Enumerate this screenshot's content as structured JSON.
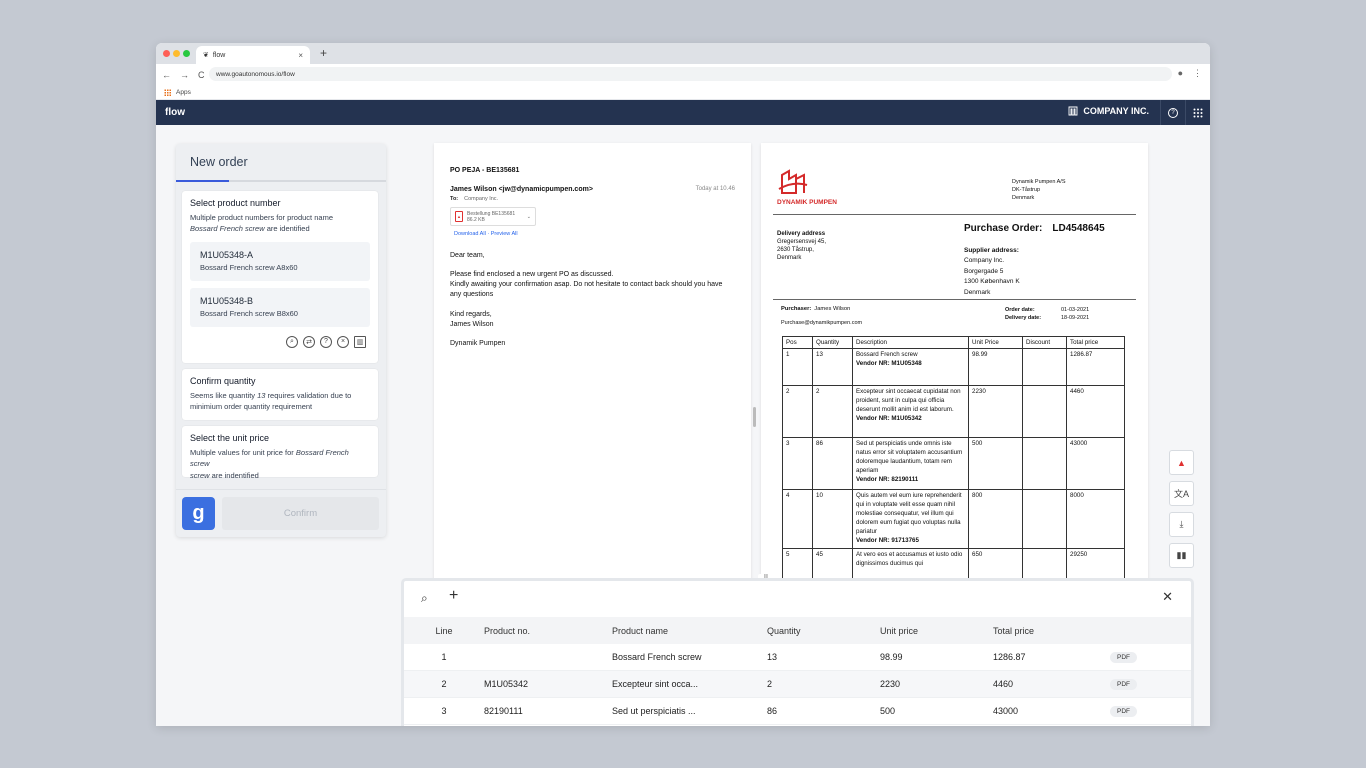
{
  "browser": {
    "tab_title": "flow",
    "tab_close": "×",
    "new_tab": "+",
    "url": "www.goautonomous.io/flow",
    "bookmark": "Apps",
    "nav_back": "←",
    "nav_forward": "→",
    "nav_reload": "C"
  },
  "appbar": {
    "brand": "flow",
    "company": "COMPANY INC.",
    "help": "?"
  },
  "panel": {
    "title": "New order",
    "progress_fraction": 0.25,
    "step1": {
      "title": "Select product number",
      "desc_part1": "Multiple product numbers for product name",
      "desc_italic": "Bossard French screw",
      "desc_part2": " are identified",
      "options": [
        {
          "number": "M1U05348-A",
          "name": "Bossard French screw A8x60"
        },
        {
          "number": "M1U05348-B",
          "name": "Bossard French screw B8x60"
        }
      ]
    },
    "step2": {
      "title": "Confirm quantity",
      "desc_part1": "Seems like quantity ",
      "desc_italic": "13",
      "desc_part2": " requires validation due to minimium order quantity requirement"
    },
    "step3": {
      "title": "Select the unit price",
      "desc_part1": "Multiple values for unit price for ",
      "desc_italic": "Bossard French screw",
      "desc_part2": " are indentified"
    },
    "logo_letter": "g",
    "confirm_label": "Confirm"
  },
  "email": {
    "subject": "PO PEJA - BE135681",
    "from": "James Wilson <jw@dynamicpumpen.com>",
    "time": "Today at 10.46",
    "to_label": "To:",
    "to_value": "Company Inc.",
    "attachment_name": "Bestellung BE135681",
    "attachment_size": "86.2 KB",
    "download_all": "Download All",
    "preview_all": "Preview All",
    "greeting": "Dear team,",
    "body_line1": "Please find enclosed a new urgent PO as discussed.",
    "body_line2": "Kindly awaiting your confirmation asap. Do not hesitate to contact back should you have any questions",
    "sign1": "Kind regards,",
    "sign2": "James Wilson",
    "company": "Dynamik Pumpen"
  },
  "po": {
    "logo_text": "DYNAMIK PUMPEN",
    "addr": [
      "Dynamik Pumpen A/S",
      "DK-Tåstrup",
      "Denmark"
    ],
    "title": "Purchase Order:",
    "number": "LD4548645",
    "delivery_label": "Delivery address",
    "delivery": [
      "Gregersensvej 45,",
      "2630 Tåstrup,",
      "Denmark"
    ],
    "supplier_label": "Supplier address:",
    "supplier": [
      "Company Inc.",
      "Borgergade 5",
      "1300 København K",
      "Denmark"
    ],
    "purchaser_label": "Purchaser:",
    "purchaser": "James Wilson",
    "purchaser_email": "Purchase@dynamikpumpen.com",
    "order_date_label": "Order date:",
    "order_date": "01-03-2021",
    "delivery_date_label": "Delivery date:",
    "delivery_date": "18-09-2021",
    "headers": [
      "Pos",
      "Quantity",
      "Description",
      "Unit Price",
      "Discount",
      "Total price"
    ],
    "rows": [
      {
        "pos": "1",
        "qty": "13",
        "desc": "Bossard French screw",
        "vendor": "Vendor NR: M1U05348",
        "unit": "98.99",
        "disc": "",
        "total": "1286.87"
      },
      {
        "pos": "2",
        "qty": "2",
        "desc": "Excepteur sint occaecat cupidatat non proident, sunt in culpa qui officia deserunt mollit anim id est laborum.",
        "vendor": "Vendor NR: M1U05342",
        "unit": "2230",
        "disc": "",
        "total": "4460"
      },
      {
        "pos": "3",
        "qty": "86",
        "desc": "Sed ut perspiciatis unde omnis iste natus error sit voluptatem accusantium doloremque laudantium, totam rem aperiam",
        "vendor": "Vendor NR: 82190111",
        "unit": "500",
        "disc": "",
        "total": "43000"
      },
      {
        "pos": "4",
        "qty": "10",
        "desc": "Quis autem vel eum iure reprehenderit qui in voluptate velit esse quam nihil molestiae consequatur, vel illum qui dolorem eum fugiat quo voluptas nulla pariatur",
        "vendor": "Vendor NR: 91713765",
        "unit": "800",
        "disc": "",
        "total": "8000"
      },
      {
        "pos": "5",
        "qty": "45",
        "desc": "At vero eos et accusamus et iusto odio dignissimos ducimus qui",
        "vendor": "",
        "unit": "650",
        "disc": "",
        "total": "29250"
      }
    ]
  },
  "grid": {
    "headers": [
      "Line",
      "Product no.",
      "Product name",
      "Quantity",
      "Unit price",
      "Total price"
    ],
    "rows": [
      {
        "line": "1",
        "product_no": "",
        "name": "Bossard French screw",
        "qty": "13",
        "unit": "98.99",
        "total": "1286.87",
        "badge": "PDF"
      },
      {
        "line": "2",
        "product_no": "M1U05342",
        "name": "Excepteur sint occa...",
        "qty": "2",
        "unit": "2230",
        "total": "4460",
        "badge": "PDF"
      },
      {
        "line": "3",
        "product_no": "82190111",
        "name": "Sed ut perspiciatis ...",
        "qty": "86",
        "unit": "500",
        "total": "43000",
        "badge": "PDF"
      }
    ]
  },
  "colors": {
    "appbar": "#243350",
    "accent": "#3b5bdb",
    "logo_red": "#d42a2a"
  }
}
